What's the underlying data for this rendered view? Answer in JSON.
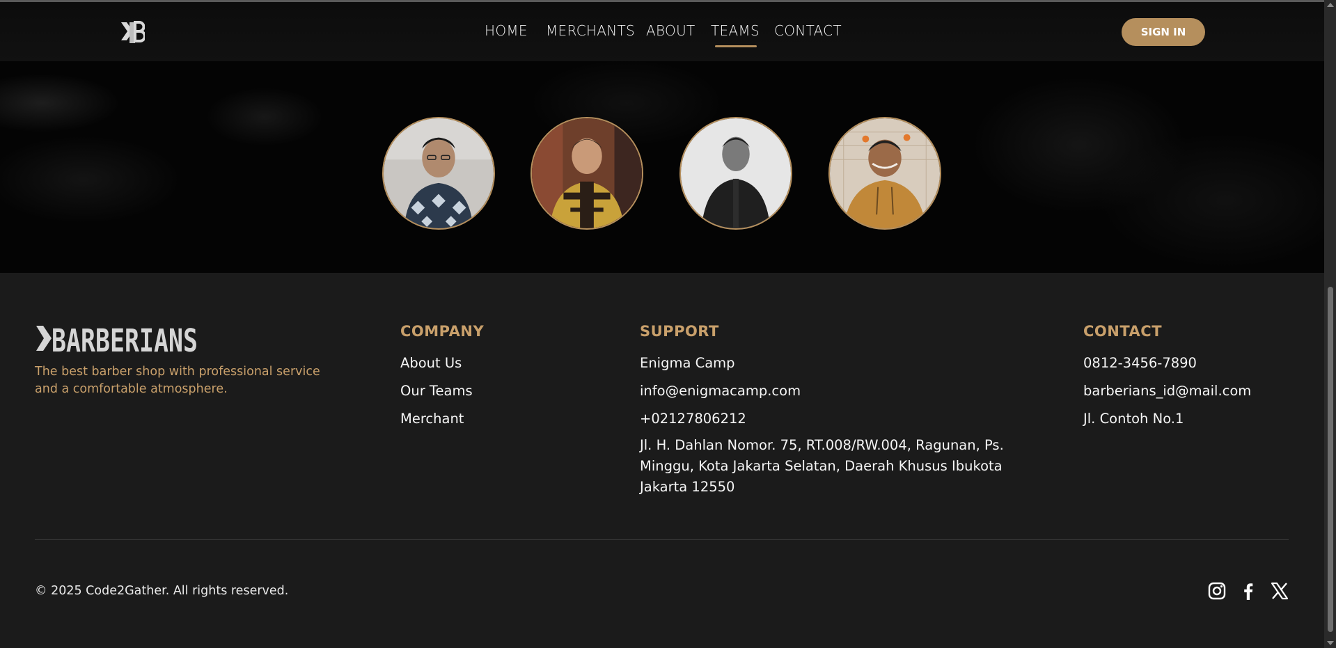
{
  "colors": {
    "accent": "#b58f5d",
    "footer_bg": "#1b1b1b",
    "nav_bg": "#0c0c0c"
  },
  "navbar": {
    "logo_icon": "barberians-k-logo-icon",
    "links": [
      {
        "label": "HOME"
      },
      {
        "label": "MERCHANTS"
      },
      {
        "label": "ABOUT"
      },
      {
        "label": "TEAMS",
        "active": true
      },
      {
        "label": "CONTACT"
      }
    ],
    "signin_label": "SIGN IN"
  },
  "teams": {
    "members": [
      {
        "photo": "team-member-photo-1"
      },
      {
        "photo": "team-member-photo-2"
      },
      {
        "photo": "team-member-photo-3"
      },
      {
        "photo": "team-member-photo-4"
      }
    ]
  },
  "footer": {
    "brand": {
      "logo_text": "BARBERIANS",
      "tagline": "The best barber shop with professional service and a comfortable atmosphere."
    },
    "company": {
      "title": "COMPANY",
      "links": [
        "About Us",
        "Our Teams",
        "Merchant"
      ]
    },
    "support": {
      "title": "SUPPORT",
      "items": [
        "Enigma Camp",
        "info@enigmacamp.com",
        "+02127806212"
      ],
      "address": "Jl. H. Dahlan Nomor. 75, RT.008/RW.004, Ragunan, Ps. Minggu, Kota Jakarta Selatan, Daerah Khusus Ibukota Jakarta 12550"
    },
    "contact": {
      "title": "CONTACT",
      "items": [
        "0812-3456-7890",
        "barberians_id@mail.com",
        "Jl. Contoh No.1"
      ]
    },
    "copyright": "© 2025 Code2Gather. All rights reserved.",
    "social": [
      "instagram-icon",
      "facebook-icon",
      "x-twitter-icon"
    ]
  }
}
